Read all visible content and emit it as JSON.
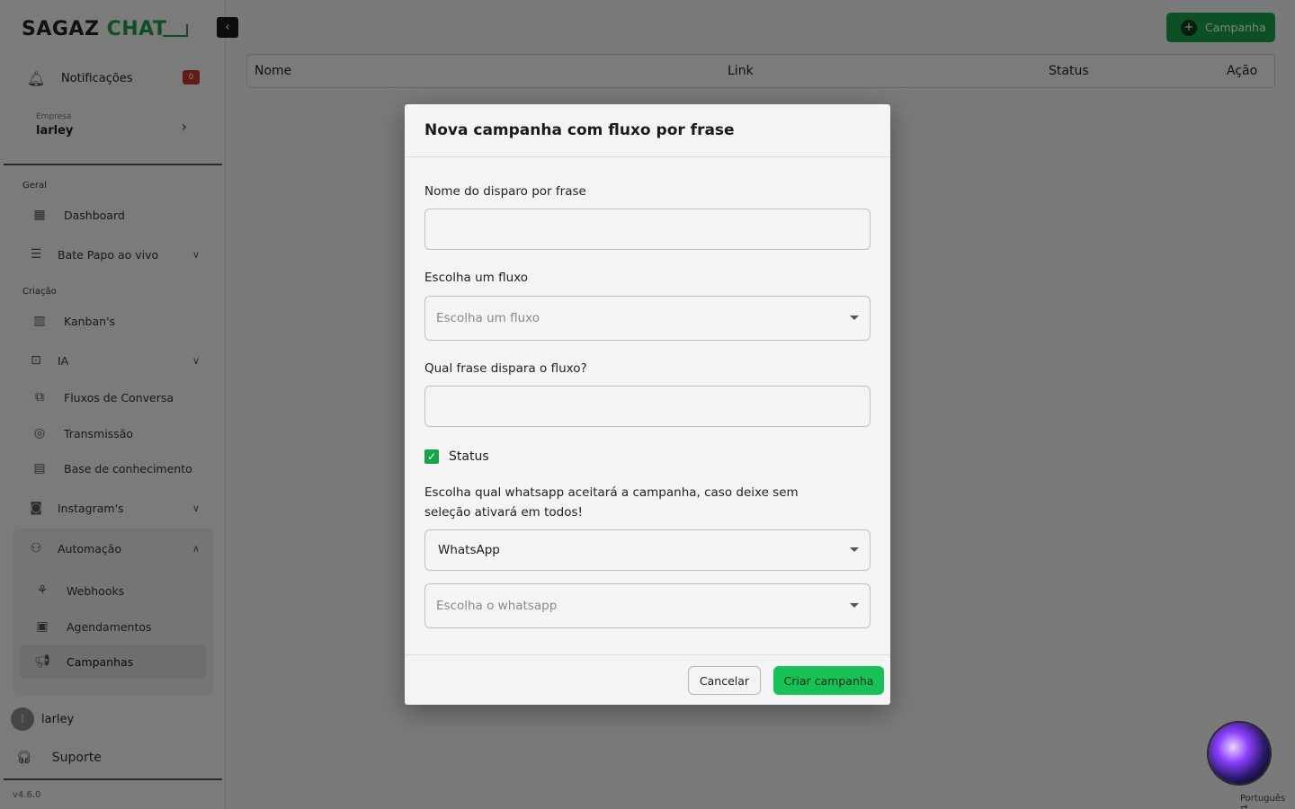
{
  "brand": {
    "name_a": "SAGAZ",
    "name_b": "CHAT"
  },
  "sidebar": {
    "notifications_label": "Notificações",
    "notifications_count": "0",
    "company_caption": "Empresa",
    "company_name": "larley",
    "sections": {
      "general": "Geral",
      "creation": "Criação"
    },
    "items": {
      "dashboard": "Dashboard",
      "live_chat": "Bate Papo ao vivo",
      "kanbans": "Kanban's",
      "ia": "IA",
      "flows": "Fluxos de Conversa",
      "broadcast": "Transmissão",
      "knowledge": "Base de conhecimento",
      "instagram": "Instagram's",
      "automation": "Automação",
      "webhooks": "Webhooks",
      "schedules": "Agendamentos",
      "campaigns": "Campanhas"
    },
    "user_initial": "l",
    "user_name": "larley",
    "support": "Suporte",
    "version": "v4.6.0"
  },
  "main": {
    "campaign_button": "Campanha",
    "columns": [
      "Nome",
      "Link",
      "Status",
      "Ação"
    ]
  },
  "modal": {
    "title": "Nova campanha com fluxo por frase",
    "name_label": "Nome do disparo por frase",
    "name_value": "",
    "flow_label": "Escolha um fluxo",
    "flow_placeholder": "Escolha um fluxo",
    "phrase_label": "Qual frase dispara o fluxo?",
    "phrase_value": "",
    "status_label": "Status",
    "status_checked": true,
    "whatsapp_label": "Escolha qual whatsapp aceitará a campanha, caso deixe sem seleção ativará em todos!",
    "channel_value": "WhatsApp",
    "whatsapp_placeholder": "Escolha o whatsapp",
    "cancel": "Cancelar",
    "create": "Criar campanha"
  },
  "footer": {
    "language": "Português"
  },
  "colors": {
    "accent": "#16a34a",
    "badge": "#c0392b"
  }
}
